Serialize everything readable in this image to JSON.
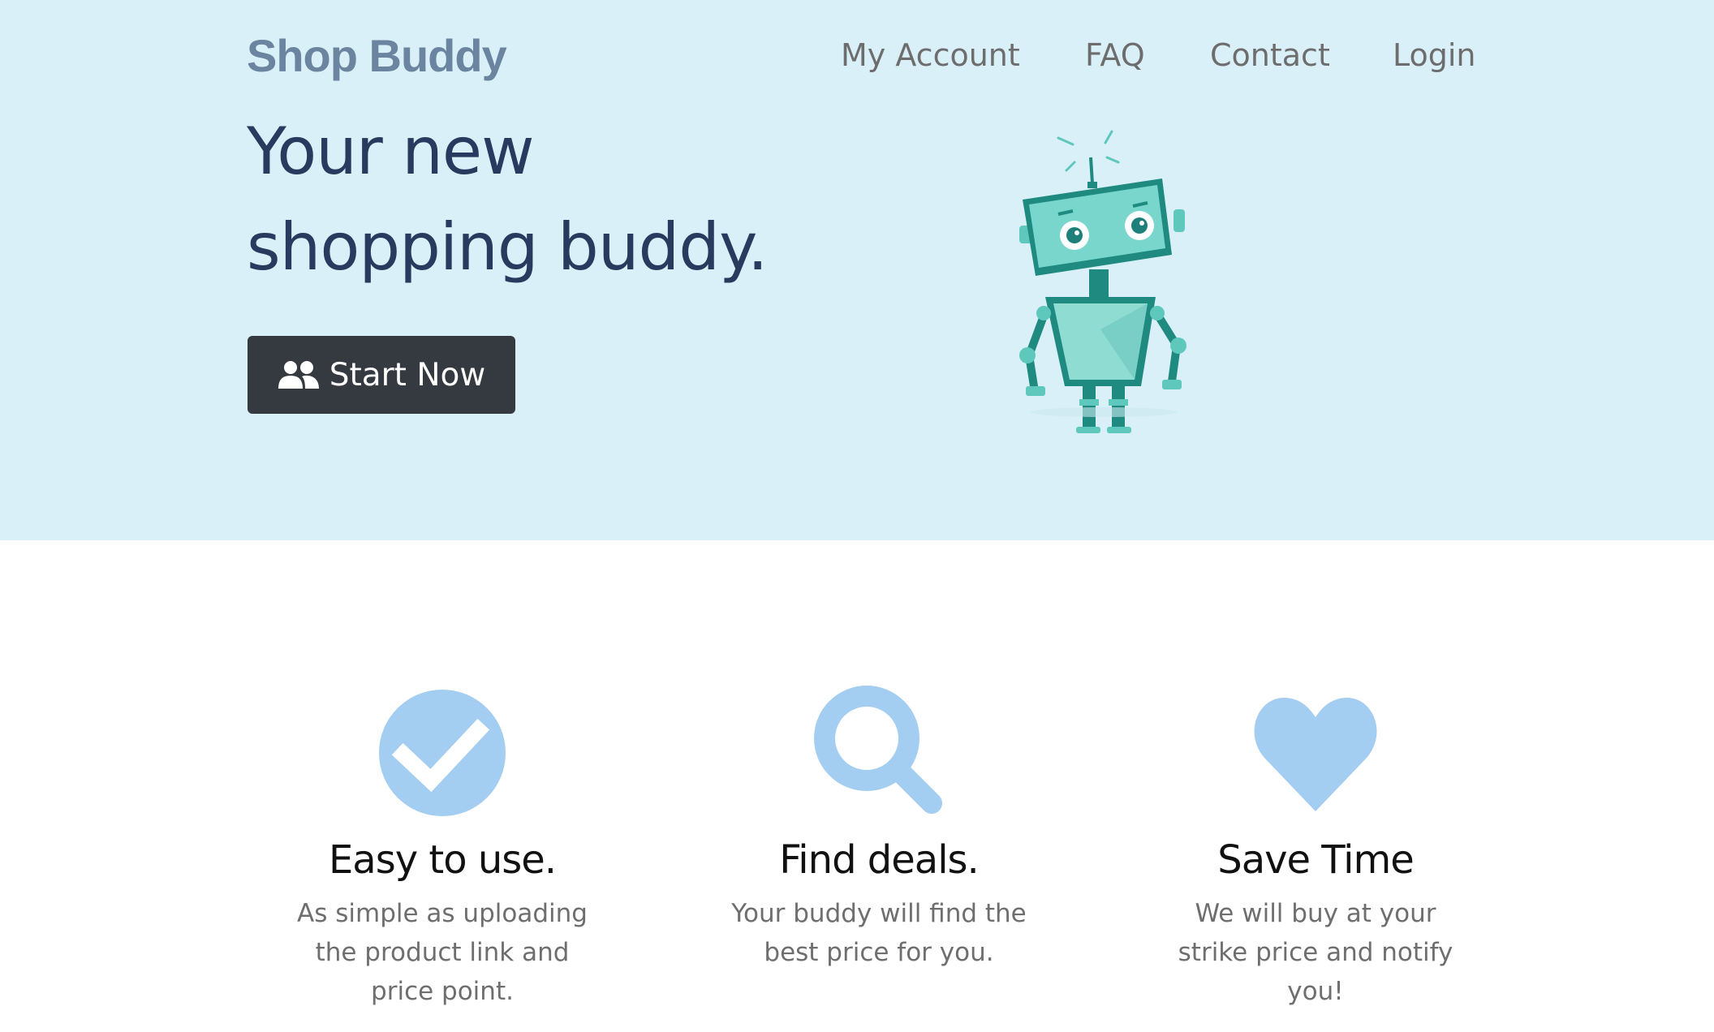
{
  "brand": "Shop Buddy",
  "nav": {
    "my_account": "My Account",
    "faq": "FAQ",
    "contact": "Contact",
    "login": "Login"
  },
  "hero": {
    "headline_line1": "Your new",
    "headline_line2": "shopping buddy.",
    "cta_label": "Start Now",
    "cta_icon": "users-icon",
    "illustration": "robot-illustration"
  },
  "features": [
    {
      "icon": "check-circle-icon",
      "title": "Easy to use.",
      "description": "As simple as uploading the product link and price point."
    },
    {
      "icon": "search-icon",
      "title": "Find deals.",
      "description": "Your buddy will find the best price for you."
    },
    {
      "icon": "heart-icon",
      "title": "Save Time",
      "description": "We will buy at your strike price and notify you!"
    }
  ],
  "colors": {
    "hero_background": "#daf0f8",
    "brand": "#6b849f",
    "headline": "#283a5e",
    "button": "#343a40",
    "feature_icon": "#a3cdf1",
    "robot": "#5ec8bd"
  }
}
